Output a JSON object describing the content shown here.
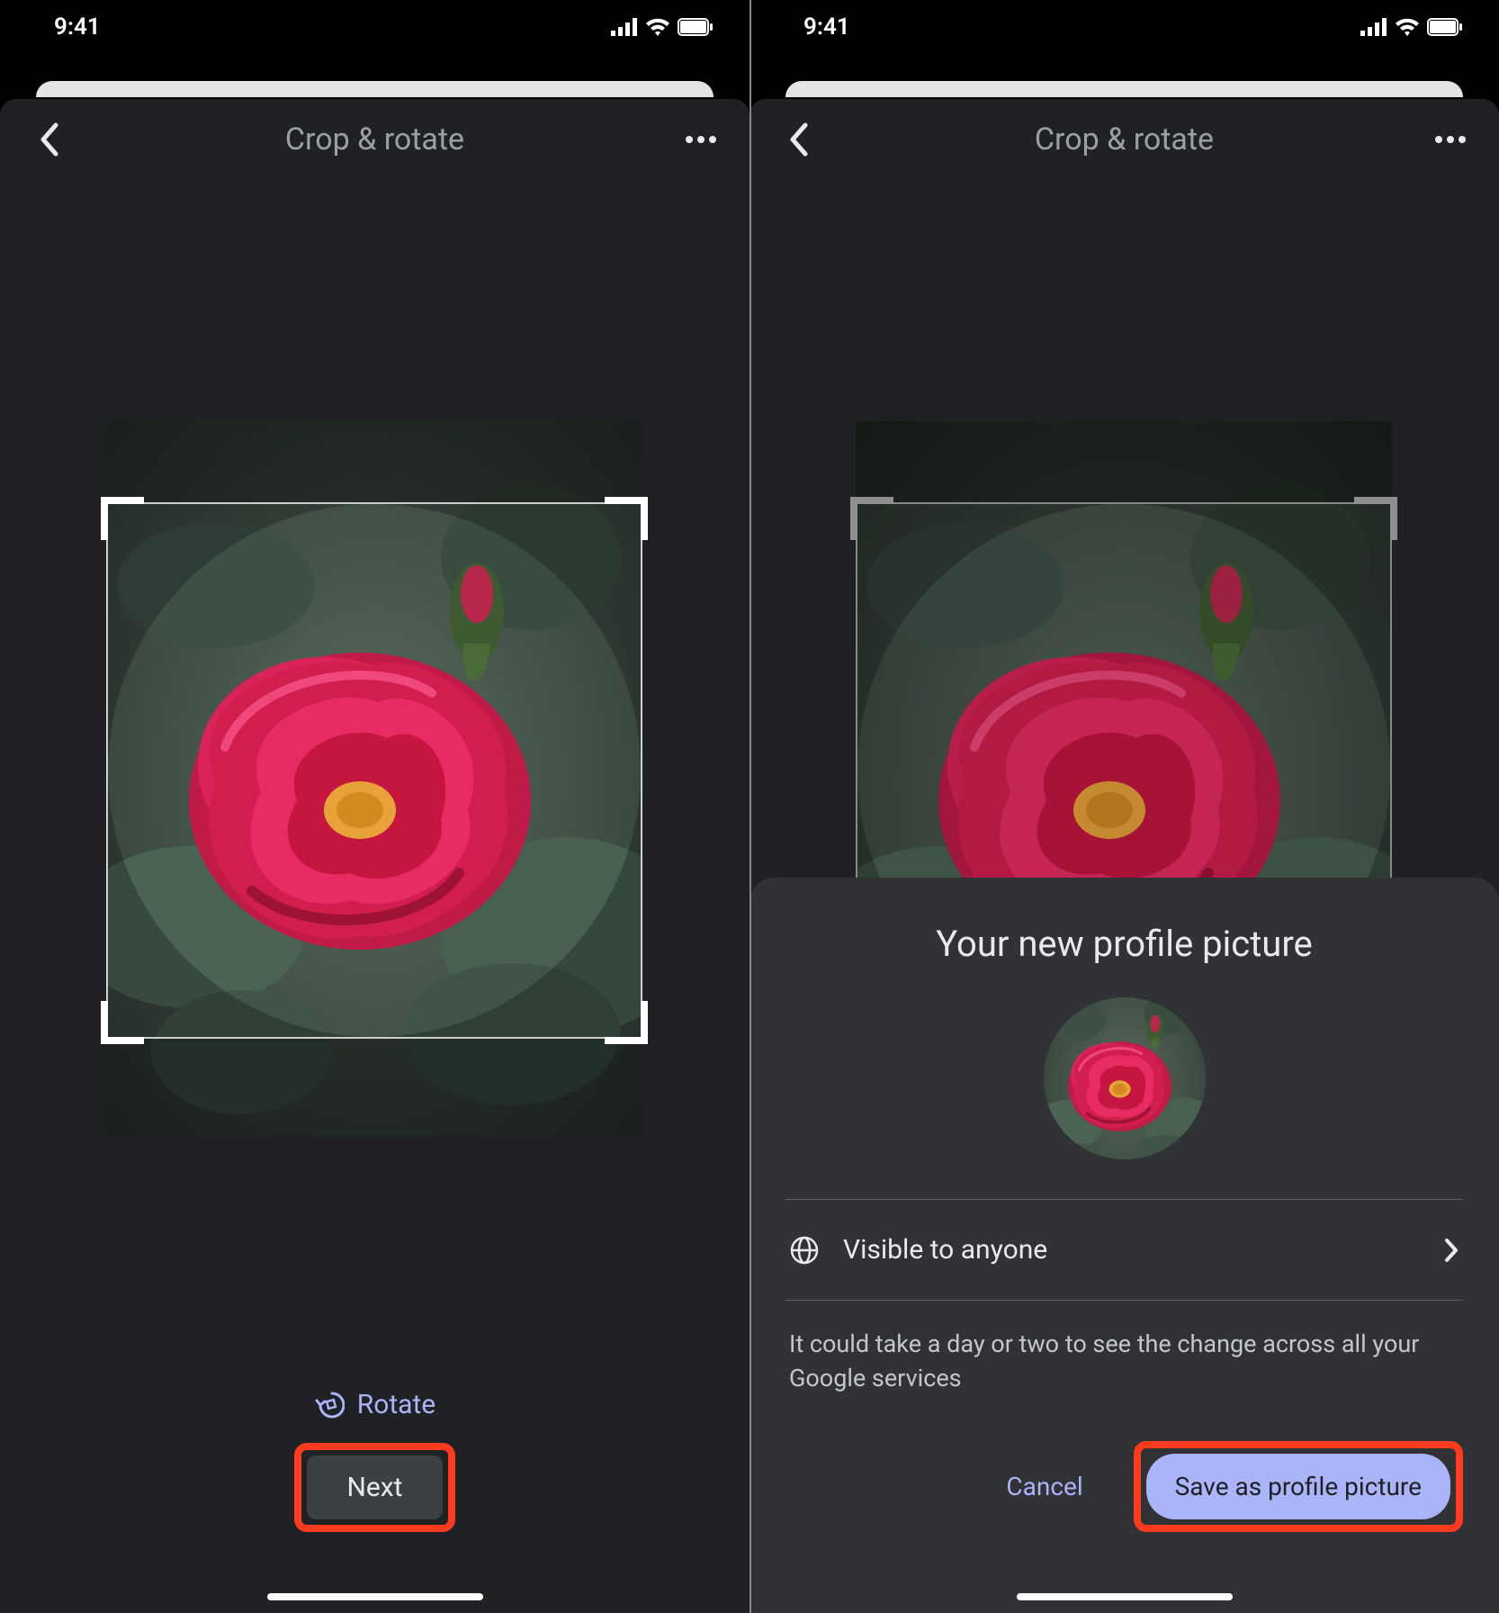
{
  "status": {
    "time": "9:41"
  },
  "header": {
    "title": "Crop & rotate"
  },
  "controls": {
    "rotate_label": "Rotate",
    "next_label": "Next"
  },
  "sheet": {
    "title": "Your new profile picture",
    "visibility_label": "Visible to anyone",
    "note": "It could take a day or two to see the change across all your Google services",
    "cancel_label": "Cancel",
    "save_label": "Save as profile picture"
  }
}
